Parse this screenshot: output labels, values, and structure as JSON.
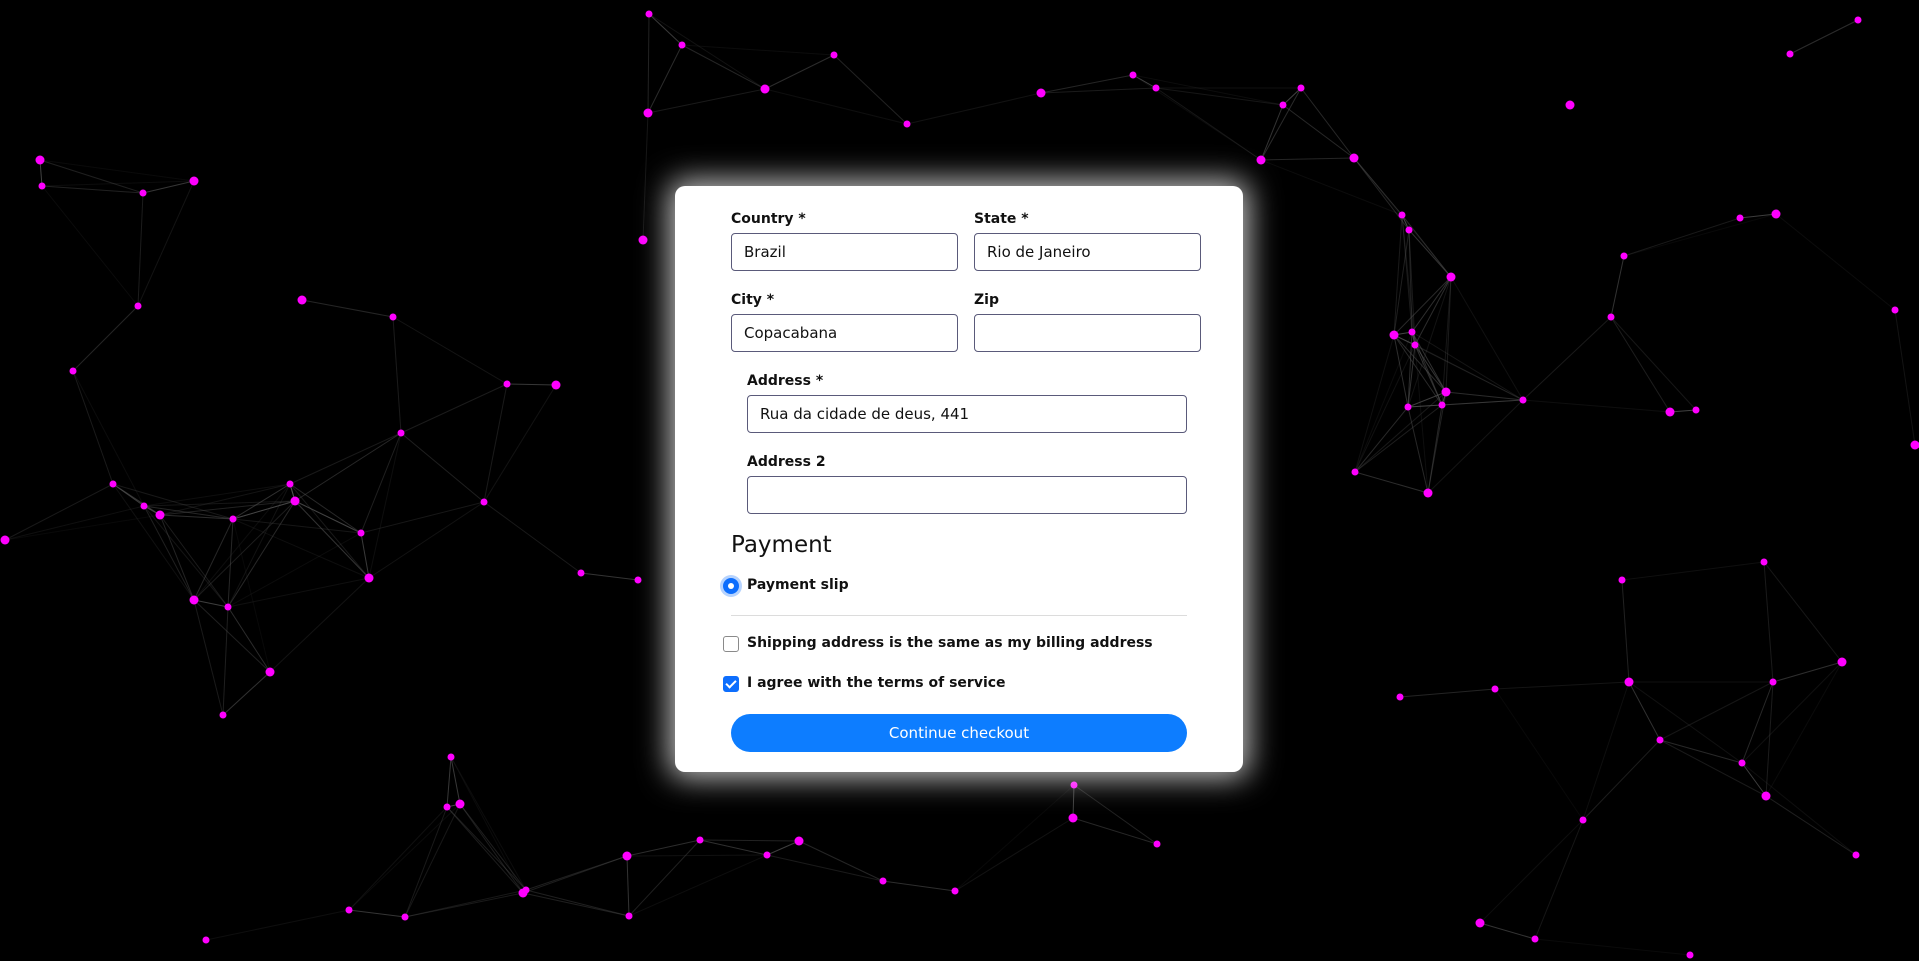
{
  "form": {
    "country": {
      "label": "Country *",
      "value": "Brazil"
    },
    "state": {
      "label": "State *",
      "value": "Rio de Janeiro"
    },
    "city": {
      "label": "City *",
      "value": "Copacabana"
    },
    "zip": {
      "label": "Zip",
      "value": ""
    },
    "address": {
      "label": "Address *",
      "value": "Rua da cidade de deus, 441"
    },
    "address2": {
      "label": "Address 2",
      "value": ""
    }
  },
  "payment": {
    "title": "Payment",
    "option_label": "Payment slip",
    "selected": true
  },
  "options": {
    "shipping_same_label": "Shipping address is the same as my billing address",
    "shipping_same_checked": false,
    "terms_label": "I agree with the terms of service",
    "terms_checked": true
  },
  "submit_label": "Continue checkout",
  "colors": {
    "background": "#000000",
    "node": "#ff00ff",
    "link": "#555555",
    "accent": "#0d7dff"
  }
}
